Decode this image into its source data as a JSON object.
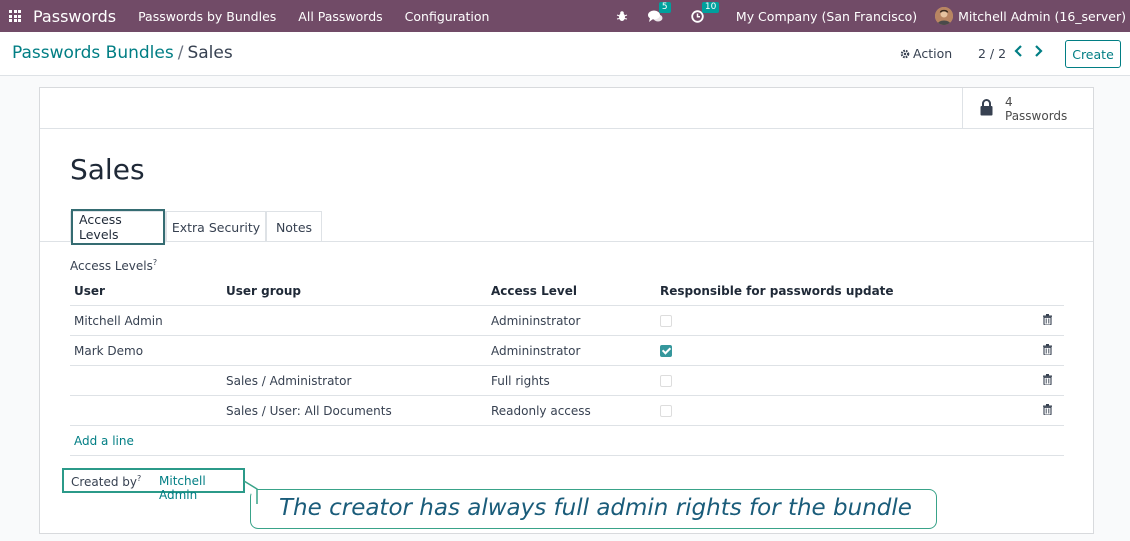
{
  "navbar": {
    "brand": "Passwords",
    "menu": [
      "Passwords by Bundles",
      "All Passwords",
      "Configuration"
    ],
    "chat_badge": "5",
    "activity_badge": "10",
    "company": "My Company (San Francisco)",
    "user": "Mitchell Admin (16_server)"
  },
  "breadcrumb": {
    "parent": "Passwords Bundles",
    "separator": "/",
    "current": "Sales"
  },
  "control": {
    "action_label": "Action",
    "pager": "2 / 2",
    "create_label": "Create"
  },
  "stat_button": {
    "value": "4",
    "label": "Passwords"
  },
  "form": {
    "title": "Sales",
    "tabs": [
      "Access Levels",
      "Extra Security",
      "Notes"
    ],
    "section_label": "Access Levels",
    "section_tooltip": "?",
    "columns": [
      "User",
      "User group",
      "Access Level",
      "Responsible for passwords update"
    ],
    "rows": [
      {
        "user": "Mitchell Admin",
        "group": "",
        "level": "Admininstrator",
        "responsible": false
      },
      {
        "user": "Mark Demo",
        "group": "",
        "level": "Admininstrator",
        "responsible": true
      },
      {
        "user": "",
        "group": "Sales / Administrator",
        "level": "Full rights",
        "responsible": false
      },
      {
        "user": "",
        "group": "Sales / User: All Documents",
        "level": "Readonly access",
        "responsible": false
      }
    ],
    "add_line": "Add a line",
    "created_by_label": "Created by",
    "created_by_tooltip": "?",
    "created_by_value": "Mitchell Admin"
  },
  "callout": {
    "text": "The creator has always full admin rights for the bundle"
  },
  "colors": {
    "navbar": "#714B67",
    "accent": "#017e84",
    "badge": "#00A09D",
    "callout_border": "#39a389",
    "callout_text": "#1a5c7a"
  }
}
